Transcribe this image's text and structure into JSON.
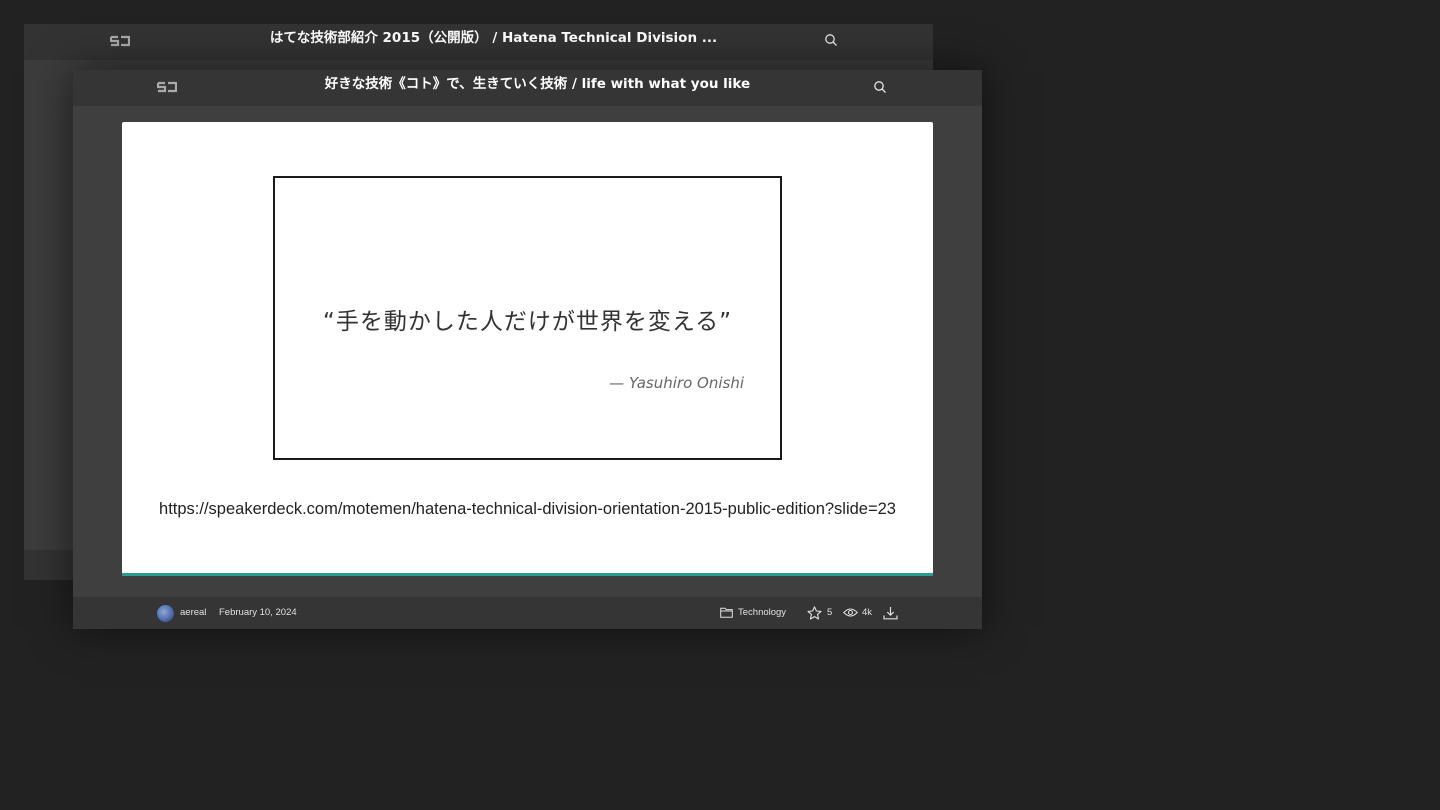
{
  "back_embed": {
    "logo_icon": "speakerdeck-logo-icon",
    "title": "はてな技術部紹介 2015（公開版） / Hatena Technical Division ...",
    "search_icon": "search-icon"
  },
  "front_embed": {
    "logo_icon": "speakerdeck-logo-icon",
    "title": "好きな技術《コト》で、生きていく技術 / life with what you like",
    "search_icon": "search-icon",
    "slide": {
      "quote": "“手を動かした人だけが世界を変える”",
      "attribution": "— Yasuhiro Onishi",
      "url": "https://speakerdeck.com/motemen/hatena-technical-division-orientation-2015-public-edition?slide=23",
      "progress_fraction": 1.0
    },
    "footer": {
      "username": "aereal",
      "date": "February 10, 2024",
      "category": "Technology",
      "stars": "5",
      "views": "4k",
      "icons": [
        "avatar",
        "folder-icon",
        "star-icon",
        "eye-icon",
        "download-icon"
      ]
    }
  },
  "colors": {
    "page_background": "#222222",
    "embed_background": "#3f3f3f",
    "bar_background": "#353535",
    "progress_accent": "#2a9d8f"
  }
}
